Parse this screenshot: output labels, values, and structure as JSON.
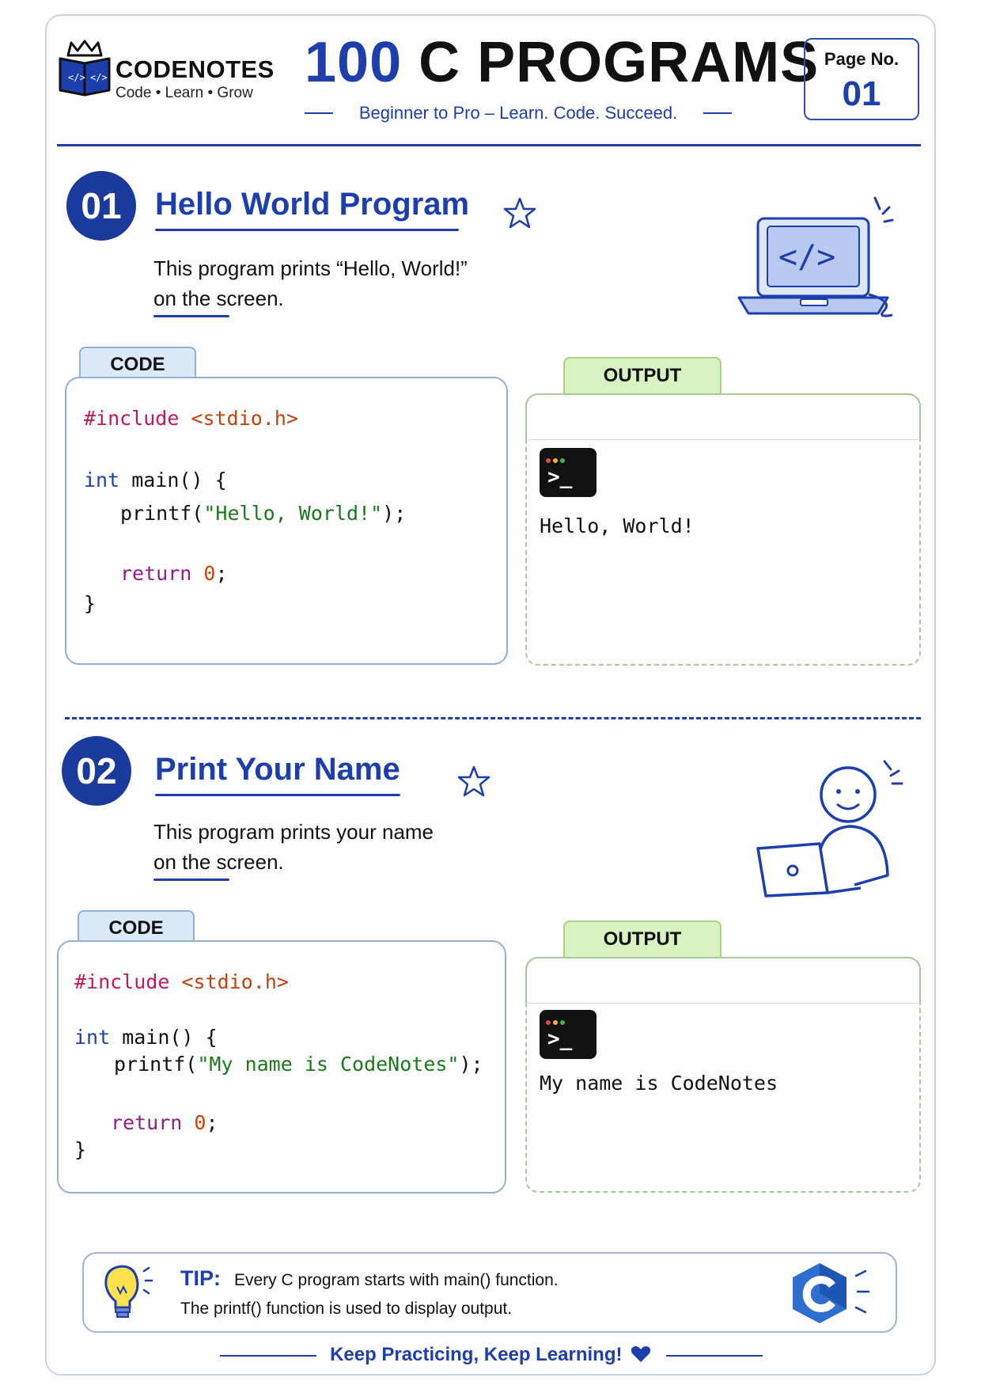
{
  "brand": {
    "name": "CODENOTES",
    "tagline": "Code • Learn • Grow"
  },
  "header": {
    "title_number": "100",
    "title_text": "C PROGRAMS",
    "subtitle": "Beginner to Pro – Learn. Code. Succeed.",
    "page_label": "Page No.",
    "page_number": "01"
  },
  "sections": [
    {
      "number": "01",
      "title": "Hello World Program",
      "description_line1": "This program prints “Hello, World!”",
      "description_line2": "on the screen.",
      "code_label": "CODE",
      "output_label": "OUTPUT",
      "code": {
        "include_directive": "#include",
        "include_header": "<stdio.h>",
        "main_type": "int",
        "main_sig": " main() {",
        "call_open": "printf(",
        "call_string": "\"Hello, World!\"",
        "call_close": ");",
        "return_kw": "return",
        "return_value": "0",
        "return_end": ";",
        "closing_brace": "}"
      },
      "terminal_prompt": ">_",
      "output": "Hello, World!",
      "illustration": "laptop-code-icon"
    },
    {
      "number": "02",
      "title": "Print Your Name",
      "description_line1": "This program prints your name",
      "description_line2": "on the screen.",
      "code_label": "CODE",
      "output_label": "OUTPUT",
      "code": {
        "include_directive": "#include",
        "include_header": "<stdio.h>",
        "main_type": "int",
        "main_sig": " main() {",
        "call_open": "printf(",
        "call_string": "\"My name is CodeNotes\"",
        "call_close": ");",
        "return_kw": "return",
        "return_value": "0",
        "return_end": ";",
        "closing_brace": "}"
      },
      "terminal_prompt": ">_",
      "output": "My name is CodeNotes",
      "illustration": "person-laptop-icon"
    }
  ],
  "tip": {
    "label": "TIP:",
    "line1": "Every C program starts with main() function.",
    "line2": "The printf() function is used to display output."
  },
  "footer": {
    "text": "Keep Practicing, Keep Learning!"
  },
  "colors": {
    "primary_blue": "#1d3fae",
    "badge_blue": "#1a3a9e",
    "code_tab_bg": "#dbe9f8",
    "output_tab_bg": "#d8f2c2",
    "preprocessor": "#c2185b",
    "string": "#1a7a1a",
    "keyword_return": "#8e1e8e",
    "number": "#d14000"
  }
}
